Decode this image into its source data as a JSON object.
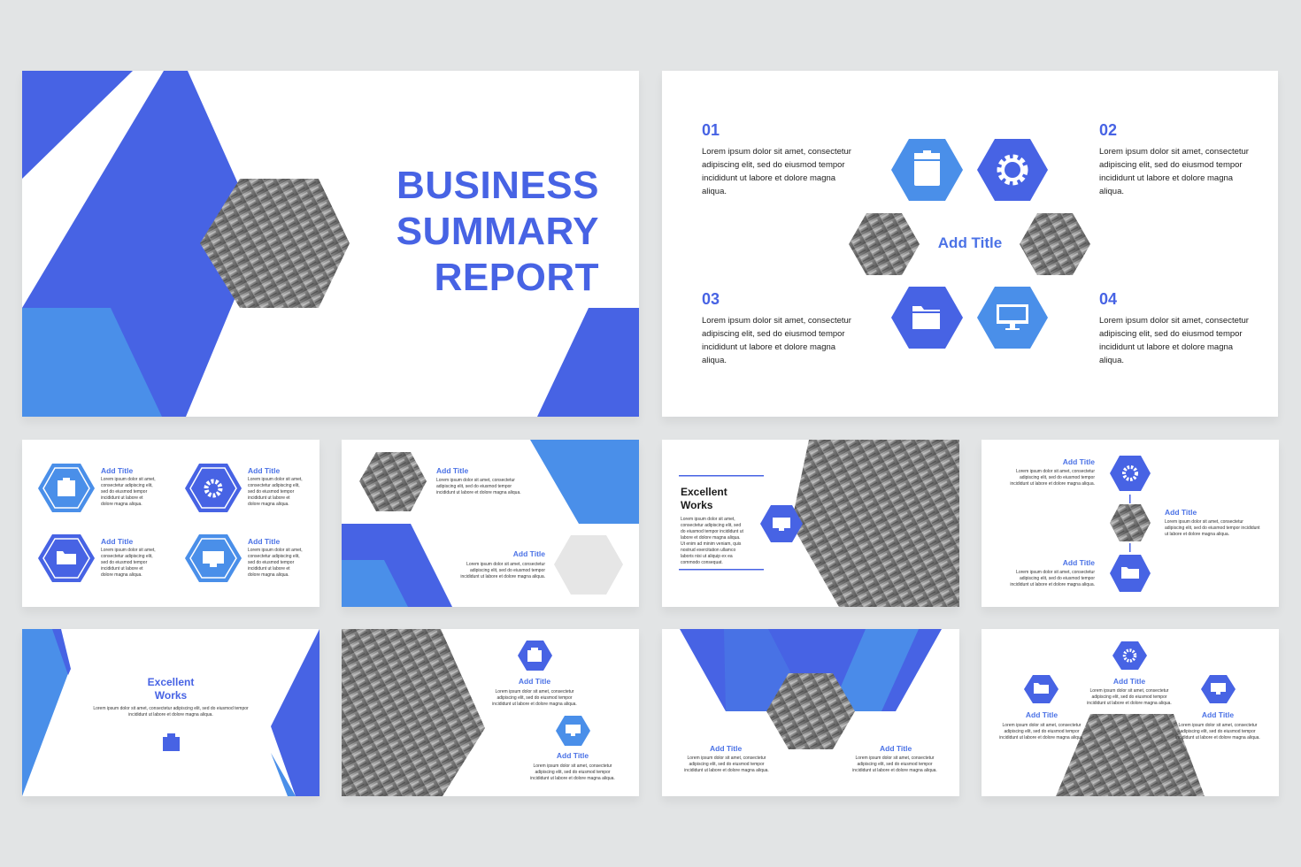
{
  "colors": {
    "primary": "#4763e4",
    "light": "#4a8fe9",
    "gray": "#8a8a8a",
    "bg": "#e2e4e5"
  },
  "slide1": {
    "title_line1": "BUSINESS",
    "title_line2": "SUMMARY",
    "title_line3": "REPORT"
  },
  "slide2": {
    "center_title": "Add Title",
    "items": [
      {
        "num": "01",
        "text": "Lorem ipsum dolor sit amet, consectetur adipiscing elit, sed do eiusmod tempor incididunt ut labore et dolore magna aliqua."
      },
      {
        "num": "02",
        "text": "Lorem ipsum dolor sit amet, consectetur adipiscing elit, sed do eiusmod tempor incididunt ut labore et dolore magna aliqua."
      },
      {
        "num": "03",
        "text": "Lorem ipsum dolor sit amet, consectetur adipiscing elit, sed do eiusmod tempor incididunt ut labore et dolore magna aliqua."
      },
      {
        "num": "04",
        "text": "Lorem ipsum dolor sit amet, consectetur adipiscing elit, sed do eiusmod tempor incididunt ut labore et dolore magna aliqua."
      }
    ],
    "icons": [
      "clipboard-icon",
      "gear-icon",
      "folder-icon",
      "monitor-icon"
    ]
  },
  "common": {
    "add_title": "Add Title",
    "lorem_short": "Lorem ipsum dolor sit amet, consectetur adipiscing elit, sed do eiusmod tempor incididunt ut labore et dolore magna aliqua.",
    "lorem_excellent": "Lorem ipsum dolor sit amet, consectetur adipiscing elit, sed do eiusmod tempor incididunt ut labore et dolore magna aliqua. Ut enim ad minim veniam, quis nostrud exercitation ullamco laboris nisi ut aliquip ex ea commodo consequat.",
    "excellent": "Excellent",
    "works": "Works"
  }
}
